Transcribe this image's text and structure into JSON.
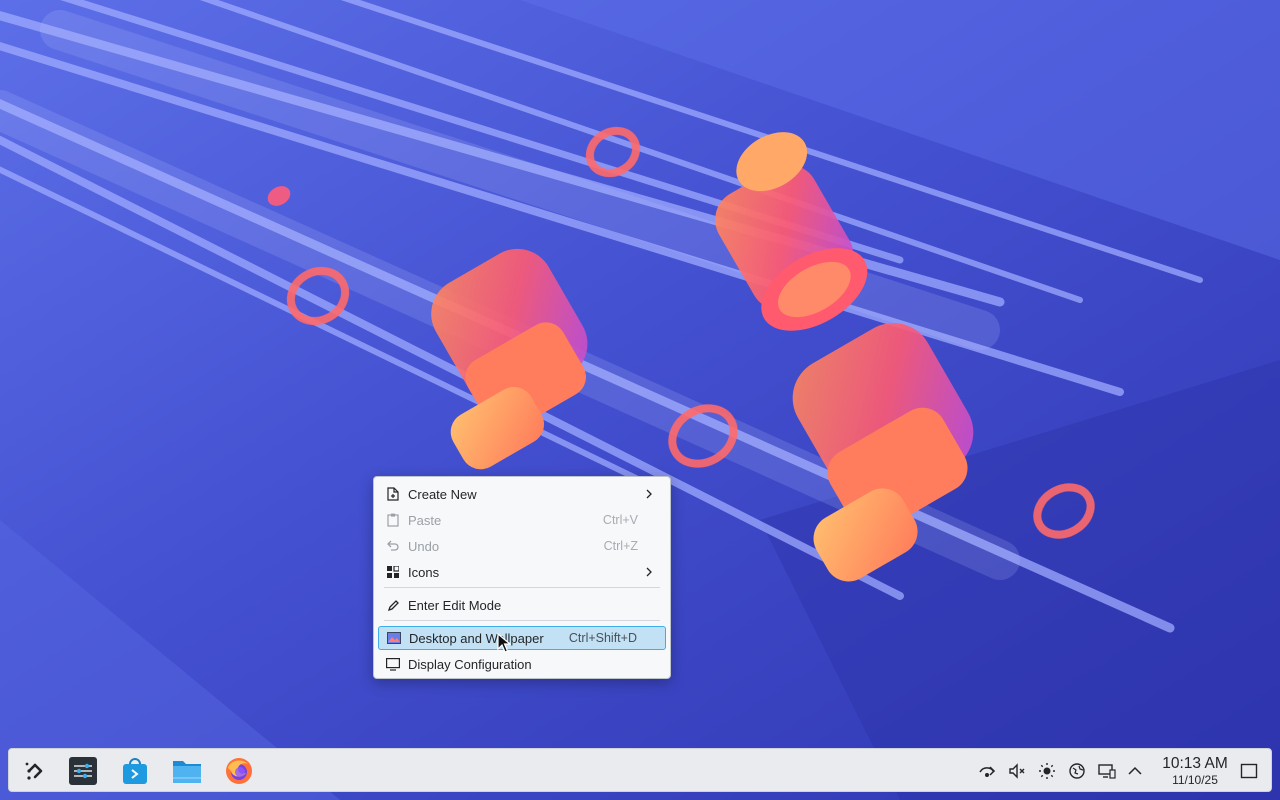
{
  "desktop": {
    "wallpaper": "abstract-rings-and-rods",
    "colors": {
      "background": "#3b47c4",
      "ring_coral": "#ff6a6a",
      "ring_orange": "#ffa060",
      "rod": "#8f9cff"
    }
  },
  "context_menu": {
    "items": [
      {
        "label": "Create New",
        "shortcut": "",
        "icon": "create-new-icon",
        "submenu": true,
        "enabled": true
      },
      {
        "label": "Paste",
        "shortcut": "Ctrl+V",
        "icon": "paste-icon",
        "submenu": false,
        "enabled": false
      },
      {
        "label": "Undo",
        "shortcut": "Ctrl+Z",
        "icon": "undo-icon",
        "submenu": false,
        "enabled": false
      },
      {
        "label": "Icons",
        "shortcut": "",
        "icon": "icons-grid-icon",
        "submenu": true,
        "enabled": true
      },
      {
        "label": "Enter Edit Mode",
        "shortcut": "",
        "icon": "edit-pencil-icon",
        "submenu": false,
        "enabled": true
      },
      {
        "label": "Desktop and Wallpaper",
        "shortcut": "Ctrl+Shift+D",
        "icon": "wallpaper-icon",
        "submenu": false,
        "enabled": true,
        "highlighted": true
      },
      {
        "label": "Display Configuration",
        "shortcut": "",
        "icon": "display-icon",
        "submenu": false,
        "enabled": true
      }
    ],
    "highlight_color": "#3daee9"
  },
  "taskbar": {
    "launchers": [
      {
        "name": "application-launcher",
        "icon": "kde-launcher-icon"
      },
      {
        "name": "system-settings",
        "icon": "settings-sliders-icon"
      },
      {
        "name": "discover",
        "icon": "discover-bag-icon"
      },
      {
        "name": "dolphin",
        "icon": "folder-icon"
      },
      {
        "name": "firefox",
        "icon": "firefox-icon"
      }
    ],
    "tray": [
      "network-icon",
      "volume-muted-icon",
      "brightness-icon",
      "globe-icon",
      "display-tray-icon",
      "chevron-up-icon"
    ],
    "clock": {
      "time": "10:13 AM",
      "date": "11/10/25"
    },
    "show_desktop_icon": "show-desktop-icon"
  }
}
